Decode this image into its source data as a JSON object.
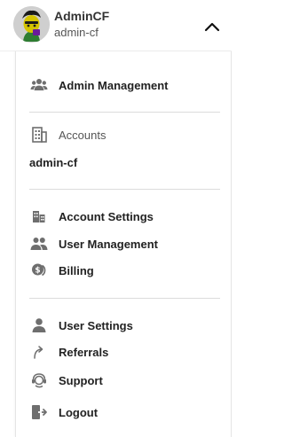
{
  "header": {
    "user_name": "AdminCF",
    "account_name": "admin-cf"
  },
  "menu": {
    "admin_management": "Admin Management",
    "accounts_heading": "Accounts",
    "current_account": "admin-cf",
    "account_settings": "Account Settings",
    "user_management": "User Management",
    "billing": "Billing",
    "user_settings": "User Settings",
    "referrals": "Referrals",
    "support": "Support",
    "logout": "Logout"
  },
  "colors": {
    "icon": "#6e6e6e",
    "text": "#222222",
    "divider": "#dcdcdc"
  }
}
